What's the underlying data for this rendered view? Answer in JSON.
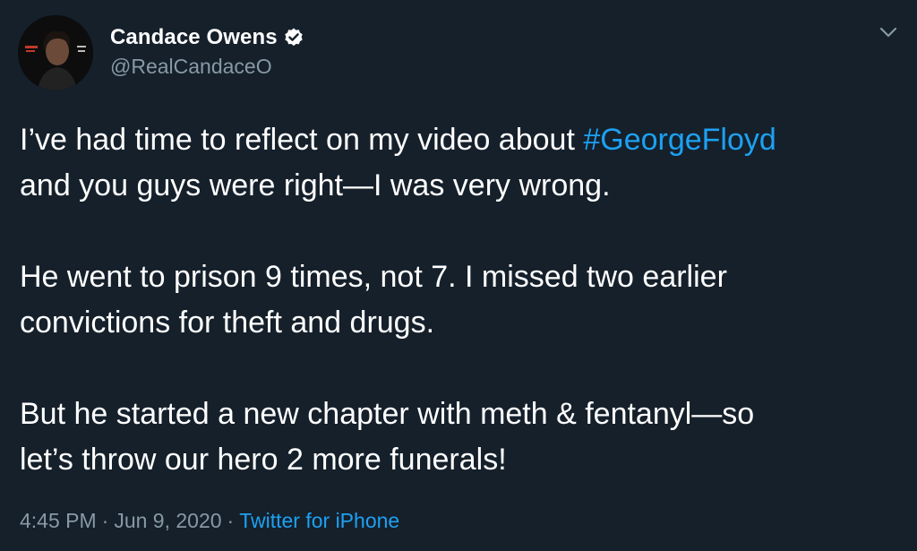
{
  "tweet": {
    "author": {
      "display_name": "Candace Owens",
      "handle": "@RealCandaceO",
      "verified": true,
      "avatar_icon": "profile-photo"
    },
    "body": {
      "paragraph1_pre": "I’ve had time to reflect on my video about ",
      "hashtag": "#GeorgeFloyd",
      "paragraph1_post": "\nand you guys were right—I was very wrong.",
      "paragraph2": "He went to prison 9 times, not 7. I missed two earlier\nconvictions for theft and drugs.",
      "paragraph3": "But he started a new chapter with meth & fentanyl—so\nlet’s throw our hero 2 more funerals!"
    },
    "meta": {
      "time": "4:45 PM",
      "separator": "·",
      "date": "Jun 9, 2020",
      "source": "Twitter for iPhone"
    }
  },
  "colors": {
    "background": "#15202b",
    "text": "#ffffff",
    "secondary": "#8899a6",
    "accent": "#1da1f2"
  },
  "icons": {
    "verified": "verified-badge-icon",
    "menu": "chevron-down-icon"
  }
}
